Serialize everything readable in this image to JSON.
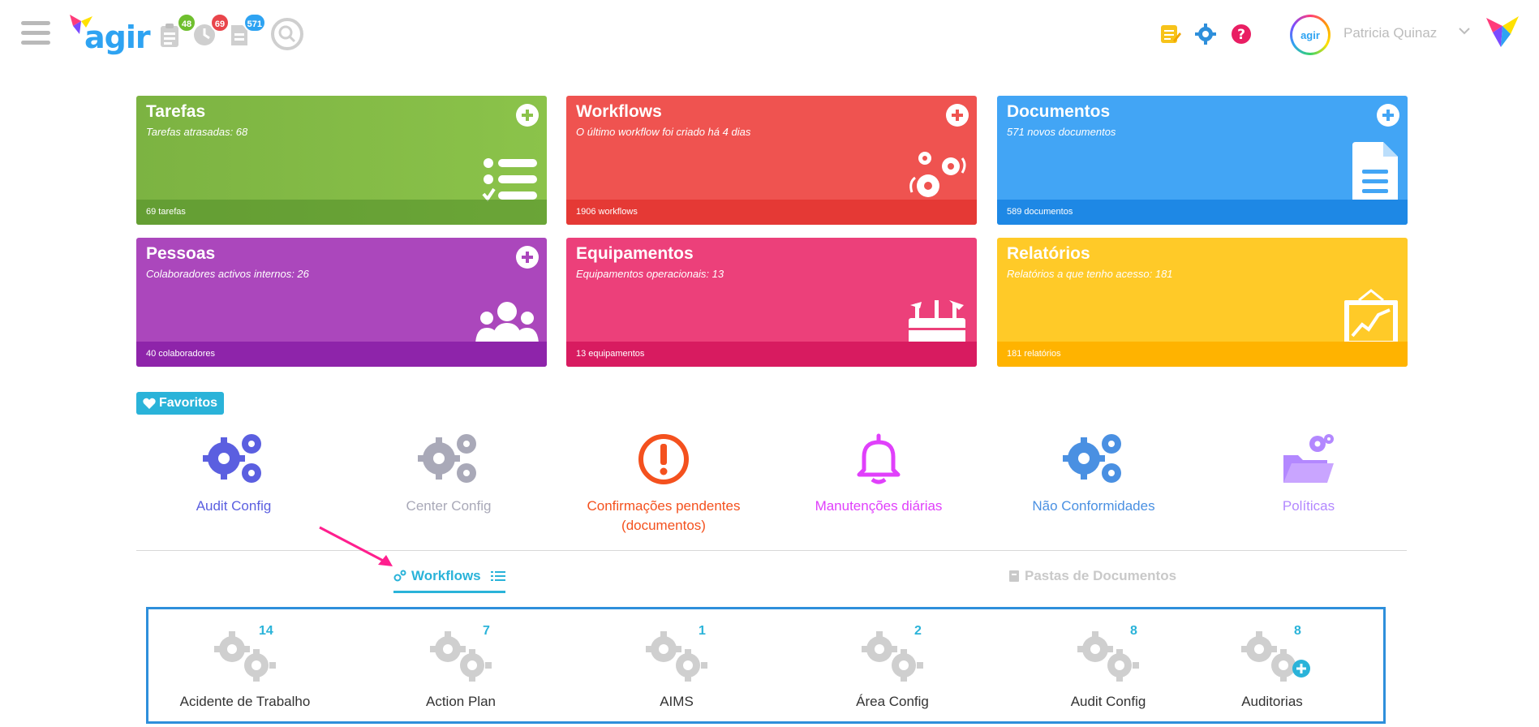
{
  "header": {
    "logo_text": "agir",
    "badges": {
      "tasks": "48",
      "workflows": "69",
      "documents": "571"
    },
    "user": {
      "name": "Patricia Quinaz",
      "avatar_text": "agir"
    },
    "colors": {
      "badge_green": "#6fbf2e",
      "badge_red": "#e9454b",
      "badge_blue": "#2ea3f2"
    },
    "icons": [
      "menu-icon",
      "clipboard-icon",
      "clock-icon",
      "document-icon",
      "search-icon",
      "notes-icon",
      "gear-icon",
      "help-icon",
      "chevron-down-icon"
    ]
  },
  "tiles": [
    {
      "title": "Tarefas",
      "subtitle": "Tarefas atrasadas: 68",
      "footer": "69 tarefas",
      "color": "#8bc34a",
      "icon": "task-list-icon"
    },
    {
      "title": "Workflows",
      "subtitle": "O último workflow foi criado há 4 dias",
      "footer": "1906 workflows",
      "color": "#ef5350",
      "icon": "workflow-gears-icon"
    },
    {
      "title": "Documentos",
      "subtitle": "571 novos documentos",
      "footer": "589 documentos",
      "color": "#42a5f5",
      "icon": "document-icon"
    },
    {
      "title": "Pessoas",
      "subtitle": "Colaboradores activos internos: 26",
      "footer": "40 colaboradores",
      "color": "#ab47bc",
      "icon": "people-icon"
    },
    {
      "title": "Equipamentos",
      "subtitle": "Equipamentos operacionais: 13",
      "footer": "13 equipamentos",
      "color": "#ec407a",
      "icon": "toolbox-icon"
    },
    {
      "title": "Relatórios",
      "subtitle": "Relatórios a que tenho acesso: 181",
      "footer": "181 relatórios",
      "color": "#ffca28",
      "icon": "chart-board-icon"
    }
  ],
  "favorites": {
    "label": "Favoritos",
    "items": [
      {
        "label": "Audit Config",
        "color": "#5b5fe0",
        "icon": "gears-icon"
      },
      {
        "label": "Center Config",
        "color": "#a9a9b8",
        "icon": "gears-icon"
      },
      {
        "label": "Confirmações pendentes (documentos)",
        "color": "#f4511e",
        "icon": "exclamation-icon"
      },
      {
        "label": "Manutenções diárias",
        "color": "#e040fb",
        "icon": "bell-icon"
      },
      {
        "label": "Não Conformidades",
        "color": "#4a90e2",
        "icon": "gears-icon"
      },
      {
        "label": "Políticas",
        "color": "#b388ff",
        "icon": "folder-gears-icon"
      }
    ]
  },
  "tabs": {
    "active": "Workflows",
    "inactive": "Pastas de Documentos",
    "accent": "#2ab3d9"
  },
  "workflows": [
    {
      "label": "Acidente de Trabalho",
      "count": "14"
    },
    {
      "label": "Action Plan",
      "count": "7"
    },
    {
      "label": "AIMS",
      "count": "1"
    },
    {
      "label": "Área Config",
      "count": "2"
    },
    {
      "label": "Audit Config",
      "count": "8"
    },
    {
      "label": "Auditorias",
      "count": "8"
    }
  ]
}
